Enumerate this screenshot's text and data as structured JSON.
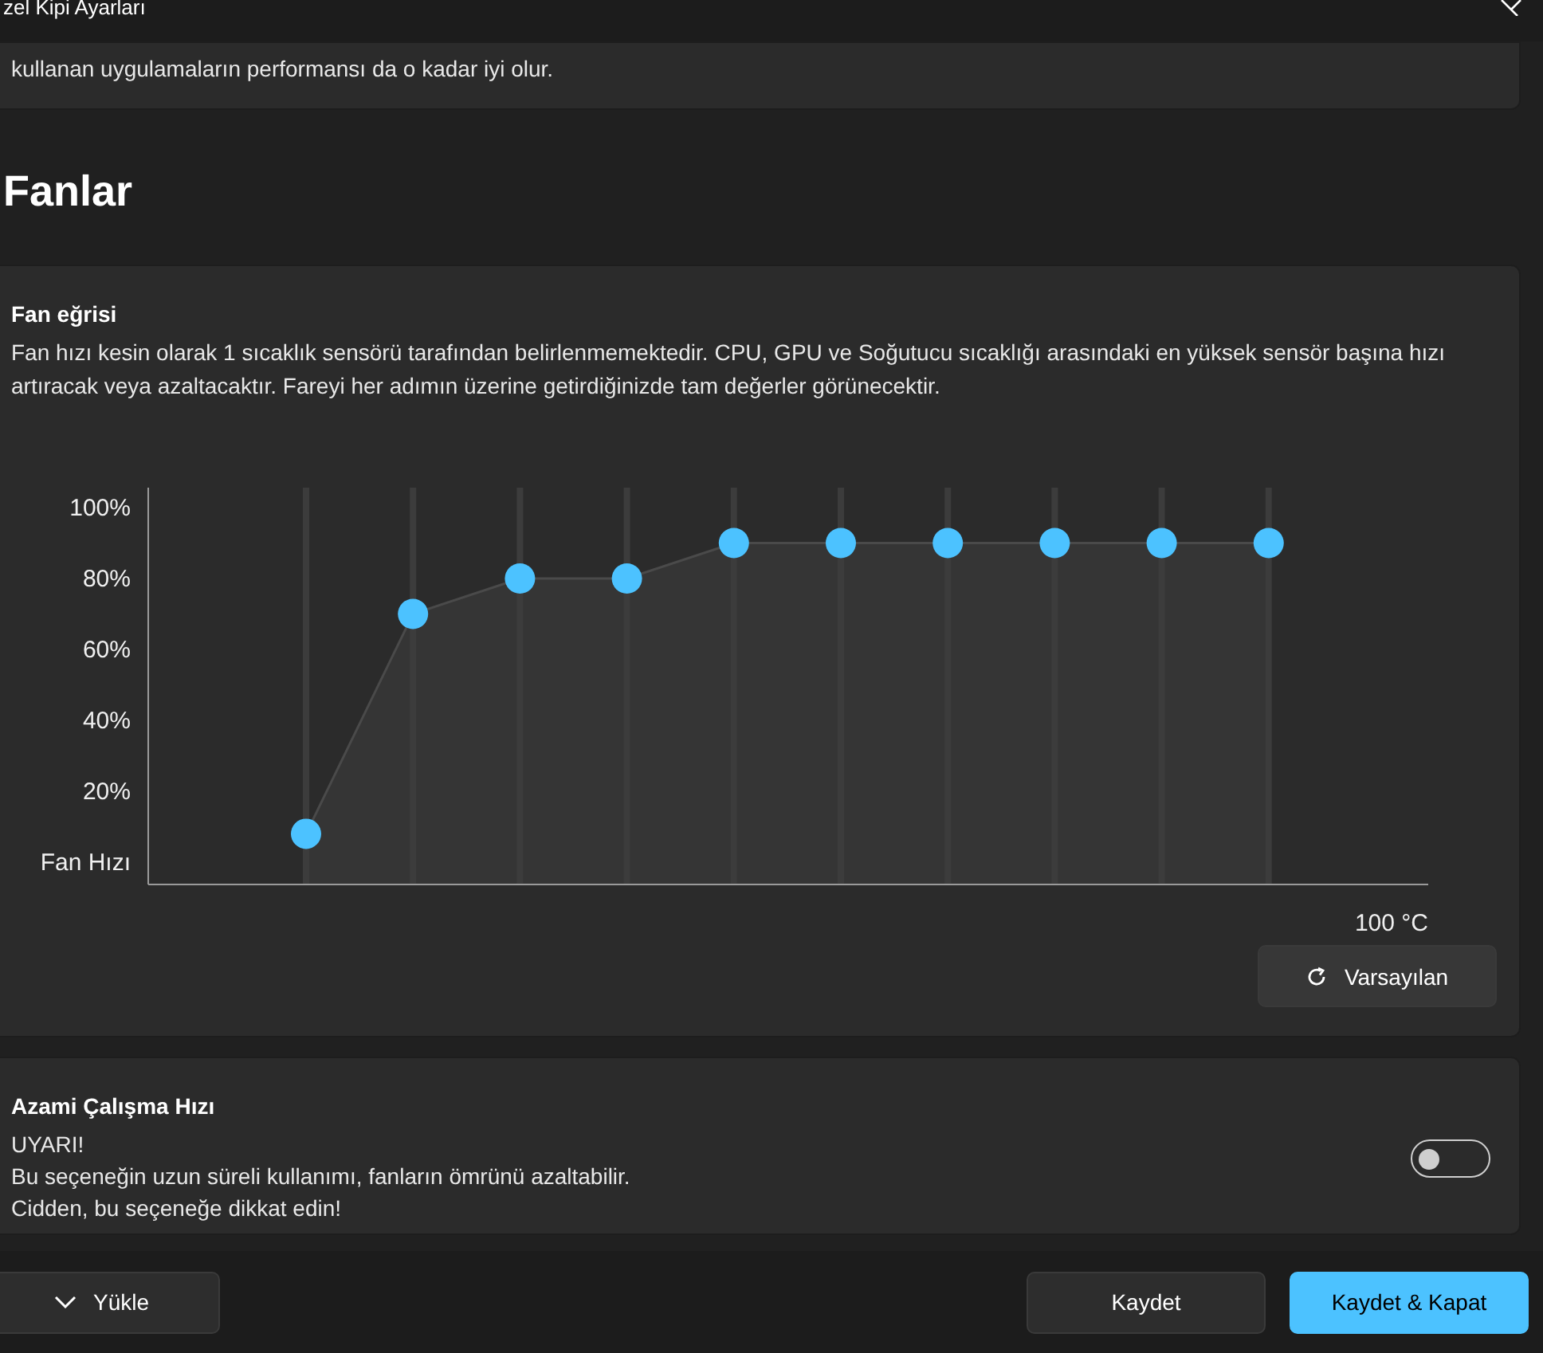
{
  "window": {
    "title": "zel Kipi Ayarları"
  },
  "top_card": {
    "description": "kullanan uygulamaların performansı da o kadar iyi olur."
  },
  "section_title": "Fanlar",
  "fan_curve": {
    "title": "Fan eğrisi",
    "description": "Fan hızı kesin olarak 1 sıcaklık sensörü tarafından belirlenmemektedir. CPU, GPU ve Soğutucu sıcaklığı arasındaki en yüksek sensör başına hızı artıracak veya azaltacaktır. Fareyi her adımın üzerine getirdiğinizde tam değerler görünecektir.",
    "curve": {
      "y_labels": [
        "100%",
        "80%",
        "60%",
        "40%",
        "20%",
        "Fan Hızı"
      ],
      "x_label": "100 °C"
    },
    "reset_button": "Varsayılan"
  },
  "max_speed": {
    "title": "Azami Çalışma Hızı",
    "warning_lines": [
      "UYARI!",
      "Bu seçeneğin uzun süreli kullanımı, fanların ömrünü azaltabilir.",
      "Cidden, bu seçeneğe dikkat edin!"
    ],
    "on": false
  },
  "footer": {
    "load_button": "Yükle",
    "save_button": "Kaydet",
    "save_close_button": "Kaydet & Kapat"
  }
}
